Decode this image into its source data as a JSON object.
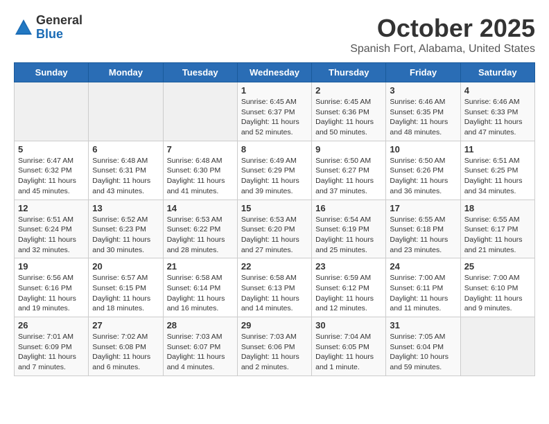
{
  "logo": {
    "general": "General",
    "blue": "Blue"
  },
  "title": "October 2025",
  "location": "Spanish Fort, Alabama, United States",
  "days_of_week": [
    "Sunday",
    "Monday",
    "Tuesday",
    "Wednesday",
    "Thursday",
    "Friday",
    "Saturday"
  ],
  "weeks": [
    [
      {
        "day": "",
        "info": ""
      },
      {
        "day": "",
        "info": ""
      },
      {
        "day": "",
        "info": ""
      },
      {
        "day": "1",
        "info": "Sunrise: 6:45 AM\nSunset: 6:37 PM\nDaylight: 11 hours\nand 52 minutes."
      },
      {
        "day": "2",
        "info": "Sunrise: 6:45 AM\nSunset: 6:36 PM\nDaylight: 11 hours\nand 50 minutes."
      },
      {
        "day": "3",
        "info": "Sunrise: 6:46 AM\nSunset: 6:35 PM\nDaylight: 11 hours\nand 48 minutes."
      },
      {
        "day": "4",
        "info": "Sunrise: 6:46 AM\nSunset: 6:33 PM\nDaylight: 11 hours\nand 47 minutes."
      }
    ],
    [
      {
        "day": "5",
        "info": "Sunrise: 6:47 AM\nSunset: 6:32 PM\nDaylight: 11 hours\nand 45 minutes."
      },
      {
        "day": "6",
        "info": "Sunrise: 6:48 AM\nSunset: 6:31 PM\nDaylight: 11 hours\nand 43 minutes."
      },
      {
        "day": "7",
        "info": "Sunrise: 6:48 AM\nSunset: 6:30 PM\nDaylight: 11 hours\nand 41 minutes."
      },
      {
        "day": "8",
        "info": "Sunrise: 6:49 AM\nSunset: 6:29 PM\nDaylight: 11 hours\nand 39 minutes."
      },
      {
        "day": "9",
        "info": "Sunrise: 6:50 AM\nSunset: 6:27 PM\nDaylight: 11 hours\nand 37 minutes."
      },
      {
        "day": "10",
        "info": "Sunrise: 6:50 AM\nSunset: 6:26 PM\nDaylight: 11 hours\nand 36 minutes."
      },
      {
        "day": "11",
        "info": "Sunrise: 6:51 AM\nSunset: 6:25 PM\nDaylight: 11 hours\nand 34 minutes."
      }
    ],
    [
      {
        "day": "12",
        "info": "Sunrise: 6:51 AM\nSunset: 6:24 PM\nDaylight: 11 hours\nand 32 minutes."
      },
      {
        "day": "13",
        "info": "Sunrise: 6:52 AM\nSunset: 6:23 PM\nDaylight: 11 hours\nand 30 minutes."
      },
      {
        "day": "14",
        "info": "Sunrise: 6:53 AM\nSunset: 6:22 PM\nDaylight: 11 hours\nand 28 minutes."
      },
      {
        "day": "15",
        "info": "Sunrise: 6:53 AM\nSunset: 6:20 PM\nDaylight: 11 hours\nand 27 minutes."
      },
      {
        "day": "16",
        "info": "Sunrise: 6:54 AM\nSunset: 6:19 PM\nDaylight: 11 hours\nand 25 minutes."
      },
      {
        "day": "17",
        "info": "Sunrise: 6:55 AM\nSunset: 6:18 PM\nDaylight: 11 hours\nand 23 minutes."
      },
      {
        "day": "18",
        "info": "Sunrise: 6:55 AM\nSunset: 6:17 PM\nDaylight: 11 hours\nand 21 minutes."
      }
    ],
    [
      {
        "day": "19",
        "info": "Sunrise: 6:56 AM\nSunset: 6:16 PM\nDaylight: 11 hours\nand 19 minutes."
      },
      {
        "day": "20",
        "info": "Sunrise: 6:57 AM\nSunset: 6:15 PM\nDaylight: 11 hours\nand 18 minutes."
      },
      {
        "day": "21",
        "info": "Sunrise: 6:58 AM\nSunset: 6:14 PM\nDaylight: 11 hours\nand 16 minutes."
      },
      {
        "day": "22",
        "info": "Sunrise: 6:58 AM\nSunset: 6:13 PM\nDaylight: 11 hours\nand 14 minutes."
      },
      {
        "day": "23",
        "info": "Sunrise: 6:59 AM\nSunset: 6:12 PM\nDaylight: 11 hours\nand 12 minutes."
      },
      {
        "day": "24",
        "info": "Sunrise: 7:00 AM\nSunset: 6:11 PM\nDaylight: 11 hours\nand 11 minutes."
      },
      {
        "day": "25",
        "info": "Sunrise: 7:00 AM\nSunset: 6:10 PM\nDaylight: 11 hours\nand 9 minutes."
      }
    ],
    [
      {
        "day": "26",
        "info": "Sunrise: 7:01 AM\nSunset: 6:09 PM\nDaylight: 11 hours\nand 7 minutes."
      },
      {
        "day": "27",
        "info": "Sunrise: 7:02 AM\nSunset: 6:08 PM\nDaylight: 11 hours\nand 6 minutes."
      },
      {
        "day": "28",
        "info": "Sunrise: 7:03 AM\nSunset: 6:07 PM\nDaylight: 11 hours\nand 4 minutes."
      },
      {
        "day": "29",
        "info": "Sunrise: 7:03 AM\nSunset: 6:06 PM\nDaylight: 11 hours\nand 2 minutes."
      },
      {
        "day": "30",
        "info": "Sunrise: 7:04 AM\nSunset: 6:05 PM\nDaylight: 11 hours\nand 1 minute."
      },
      {
        "day": "31",
        "info": "Sunrise: 7:05 AM\nSunset: 6:04 PM\nDaylight: 10 hours\nand 59 minutes."
      },
      {
        "day": "",
        "info": ""
      }
    ]
  ]
}
